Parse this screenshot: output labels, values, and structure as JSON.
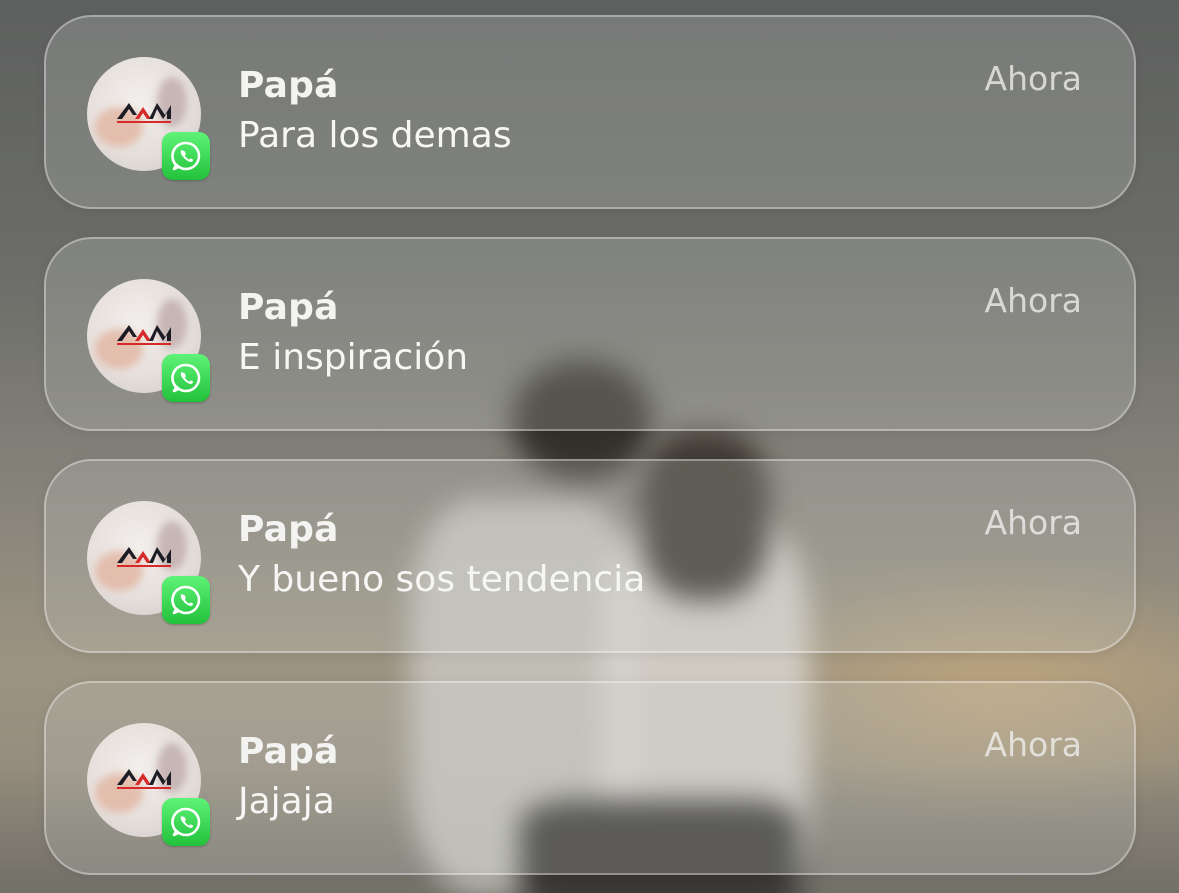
{
  "notifications": [
    {
      "sender": "Papá",
      "message": "Para los demas",
      "time": "Ahora",
      "app_icon": "whatsapp-icon",
      "avatar_logo": "AM"
    },
    {
      "sender": "Papá",
      "message": "E inspiración",
      "time": "Ahora",
      "app_icon": "whatsapp-icon",
      "avatar_logo": "AM"
    },
    {
      "sender": "Papá",
      "message": "Y bueno sos tendencia",
      "time": "Ahora",
      "app_icon": "whatsapp-icon",
      "avatar_logo": "AM"
    },
    {
      "sender": "Papá",
      "message": "Jajaja",
      "time": "Ahora",
      "app_icon": "whatsapp-icon",
      "avatar_logo": "AM"
    }
  ],
  "colors": {
    "whatsapp_green": "#25D366",
    "logo_red": "#d62a2a",
    "logo_dark": "#1c1c24"
  }
}
